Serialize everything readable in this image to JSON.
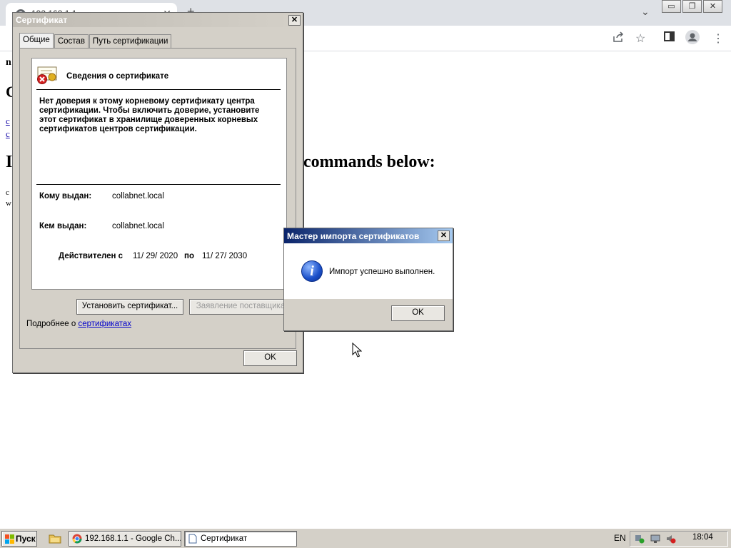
{
  "browser": {
    "tab_title": "192.168.1.1",
    "new_tab": "+",
    "tabs_menu": "⌄",
    "window_controls": [
      "▭",
      "❐",
      "✕"
    ],
    "toolbar_icons": [
      "share-icon",
      "star-icon",
      "sidepanel-icon",
      "profile-icon",
      "menu-icon"
    ]
  },
  "page": {
    "fragment_n": "n",
    "heading_c": "C",
    "link_1": "c",
    "link_2": "c",
    "heading_i": "I",
    "heading_commands": "commands below:",
    "small_c": "c",
    "small_w": "w"
  },
  "cert_dialog": {
    "title": "Сертификат",
    "tabs": [
      "Общие",
      "Состав",
      "Путь сертификации"
    ],
    "info_title": "Сведения о сертификате",
    "warning": "Нет доверия к этому корневому сертификату центра сертификации. Чтобы включить доверие, установите этот сертификат в хранилище доверенных корневых сертификатов центров сертификации.",
    "issued_to_label": "Кому выдан:",
    "issued_to_value": "collabnet.local",
    "issued_by_label": "Кем выдан:",
    "issued_by_value": "collabnet.local",
    "valid_from_label": "Действителен с",
    "valid_from_value": "11/ 29/ 2020",
    "valid_to_label": "по",
    "valid_to_value": "11/ 27/ 2030",
    "install_button": "Установить сертификат...",
    "issuer_statement_button": "Заявление поставщика",
    "more_info_prefix": "Подробнее о",
    "more_info_link": "сертификатах",
    "ok_button": "OK"
  },
  "msg_dialog": {
    "title": "Мастер импорта сертификатов",
    "message": "Импорт успешно выполнен.",
    "ok_button": "OK"
  },
  "taskbar": {
    "start_label": "Пуск",
    "tasks": [
      "192.168.1.1 - Google Ch...",
      "Сертификат"
    ],
    "language": "EN",
    "clock": "18:04"
  },
  "colors": {
    "dialog_face": "#d4d0c8",
    "msg_titlebar": "#0a246a",
    "link": "#0000cc"
  }
}
